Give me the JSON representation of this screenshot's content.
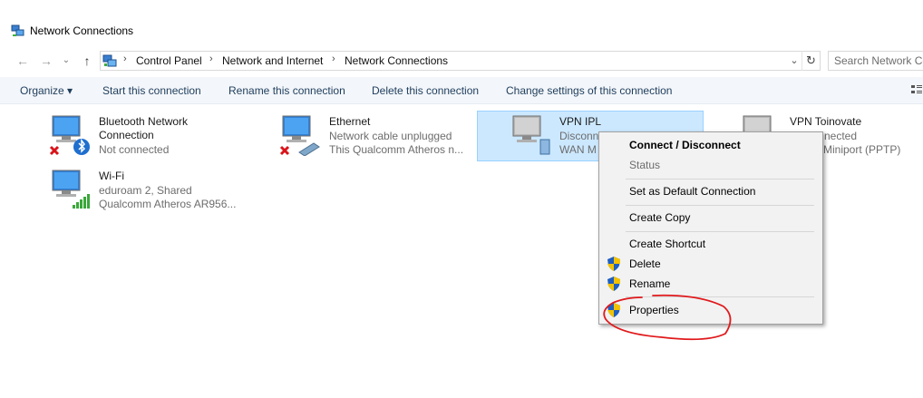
{
  "window": {
    "title": "Network Connections"
  },
  "navigation": {
    "back_icon": "back-arrow-icon",
    "forward_icon": "forward-arrow-icon",
    "up_icon": "up-arrow-icon",
    "breadcrumb": [
      "Control Panel",
      "Network and Internet",
      "Network Connections"
    ],
    "search_placeholder": "Search Network Co"
  },
  "commands": {
    "organize": "Organize ▾",
    "start": "Start this connection",
    "rename": "Rename this connection",
    "delete": "Delete this connection",
    "change_settings": "Change settings of this connection"
  },
  "connections": [
    {
      "name_line1": "Bluetooth Network",
      "name_line2": "Connection",
      "status": "Not connected",
      "device": ""
    },
    {
      "name_line1": "Ethernet",
      "name_line2": "",
      "status": "Network cable unplugged",
      "device": "This Qualcomm Atheros n..."
    },
    {
      "name_line1": "VPN IPL",
      "name_line2": "",
      "status": "Disconn",
      "device": "WAN M"
    },
    {
      "name_line1": "VPN Toinovate",
      "name_line2": "",
      "status": "nected",
      "device": "Miniport (PPTP)"
    },
    {
      "name_line1": "Wi-Fi",
      "name_line2": "",
      "status": "eduroam 2, Shared",
      "device": "Qualcomm Atheros AR956..."
    }
  ],
  "context_menu": {
    "connect": "Connect / Disconnect",
    "status": "Status",
    "set_default": "Set as Default Connection",
    "create_copy": "Create Copy",
    "create_shortcut": "Create Shortcut",
    "delete": "Delete",
    "rename": "Rename",
    "properties": "Properties"
  },
  "colors": {
    "selection": "#cce8ff",
    "command_bar": "#f3f6fa",
    "annotation": "#e0191c",
    "shield_blue": "#1f5fbf",
    "shield_yellow": "#f2c200"
  }
}
